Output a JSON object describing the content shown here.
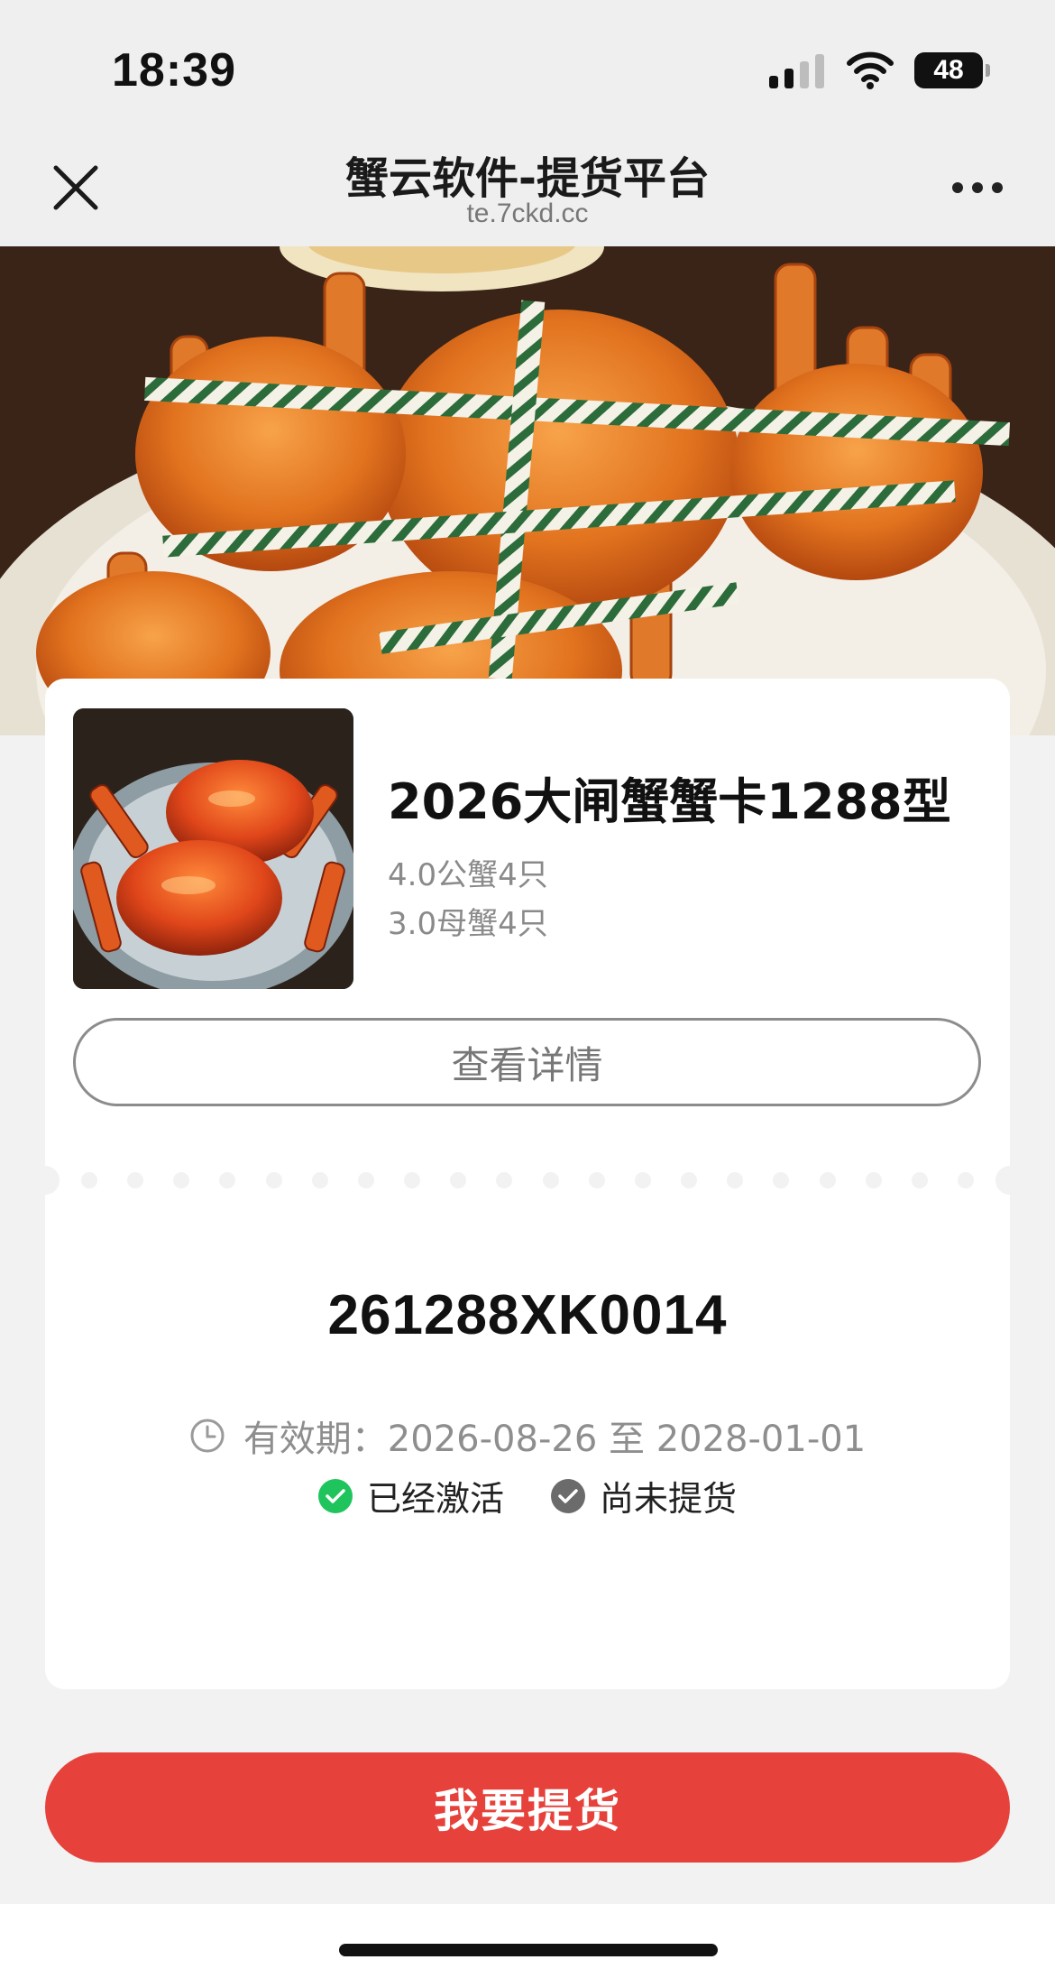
{
  "status_bar": {
    "time": "18:39",
    "battery": "48",
    "signal_icon": "signal-bars-icon",
    "wifi_icon": "wifi-icon",
    "battery_icon": "battery-icon"
  },
  "header": {
    "title": "蟹云软件-提货平台",
    "url": "te.7ckd.cc",
    "close_icon": "close-icon",
    "more_icon": "more-dots-icon"
  },
  "hero": {
    "image": "hairy-crabs-photo"
  },
  "card": {
    "product_image": "steamed-crabs-photo",
    "product_title": "2026大闸蟹蟹卡1288型",
    "specs": [
      "4.0公蟹4只",
      "3.0母蟹4只"
    ],
    "details_button": "查看详情",
    "code": "261288XK0014",
    "validity": "有效期：2026-08-26 至 2028-01-01",
    "statuses": [
      {
        "label": "已经激活",
        "color": "#1fc55c",
        "icon": "check-circle-green-icon"
      },
      {
        "label": "尚未提货",
        "color": "#6b6b6b",
        "icon": "check-circle-gray-icon"
      }
    ]
  },
  "cta": {
    "label": "我要提货",
    "color": "#e6413b"
  }
}
